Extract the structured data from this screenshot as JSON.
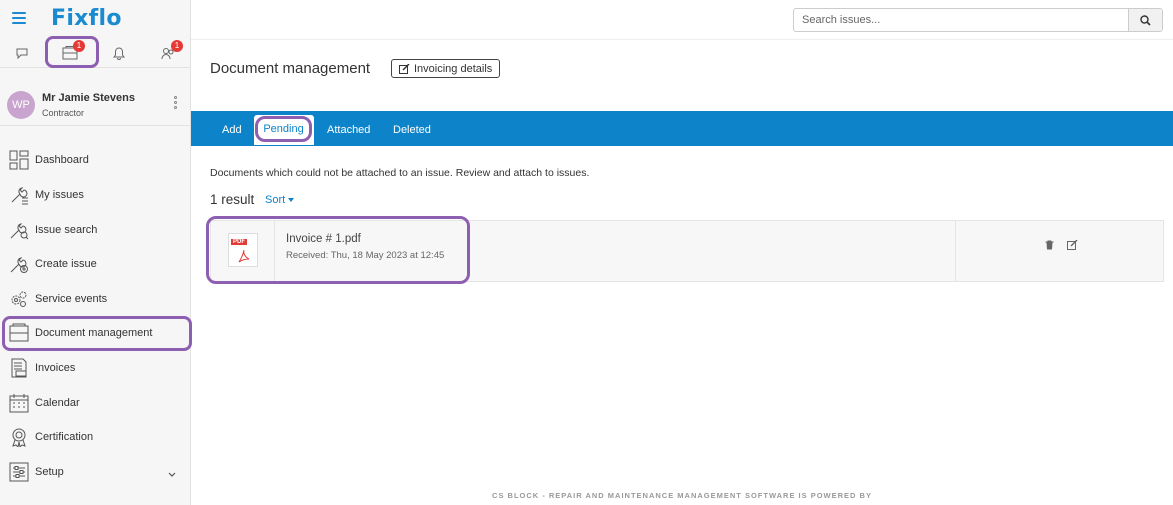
{
  "brand": {
    "logo": "Fixflo"
  },
  "top_icons": [
    {
      "name": "chat-icon"
    },
    {
      "name": "document-inbox-icon",
      "badge": "1"
    },
    {
      "name": "bell-icon"
    },
    {
      "name": "people-icon",
      "badge": "1"
    }
  ],
  "user": {
    "initials": "WP",
    "name": "Mr Jamie Stevens",
    "role": "Contractor"
  },
  "sidebar": {
    "items": [
      {
        "label": "Dashboard",
        "icon": "dashboard-icon"
      },
      {
        "label": "My issues",
        "icon": "wrench-list-icon"
      },
      {
        "label": "Issue search",
        "icon": "wrench-search-icon"
      },
      {
        "label": "Create issue",
        "icon": "wrench-plus-icon"
      },
      {
        "label": "Service events",
        "icon": "gears-icon"
      },
      {
        "label": "Document management",
        "icon": "document-inbox-icon",
        "active": true
      },
      {
        "label": "Invoices",
        "icon": "invoice-icon"
      },
      {
        "label": "Calendar",
        "icon": "calendar-icon"
      },
      {
        "label": "Certification",
        "icon": "certificate-icon"
      },
      {
        "label": "Setup",
        "icon": "sliders-icon",
        "expandable": true
      }
    ]
  },
  "search": {
    "placeholder": "Search issues..."
  },
  "page": {
    "title": "Document management",
    "invoicing_button": "Invoicing details"
  },
  "tabs": [
    {
      "label": "Add"
    },
    {
      "label": "Pending",
      "active": true
    },
    {
      "label": "Attached"
    },
    {
      "label": "Deleted"
    }
  ],
  "content": {
    "description": "Documents which could not be attached to an issue. Review and attach to issues.",
    "result_count": "1 result",
    "sort_label": "Sort"
  },
  "documents": [
    {
      "name": "Invoice # 1.pdf",
      "received": "Received: Thu, 18 May 2023 at 12:45",
      "type_tag": "PDF"
    }
  ],
  "footer": {
    "text": "CS BLOCK - REPAIR AND MAINTENANCE MANAGEMENT SOFTWARE IS POWERED BY"
  },
  "colors": {
    "brand_blue": "#0d83c9",
    "highlight_purple": "#8e5fb0",
    "badge_red": "#e53935"
  }
}
